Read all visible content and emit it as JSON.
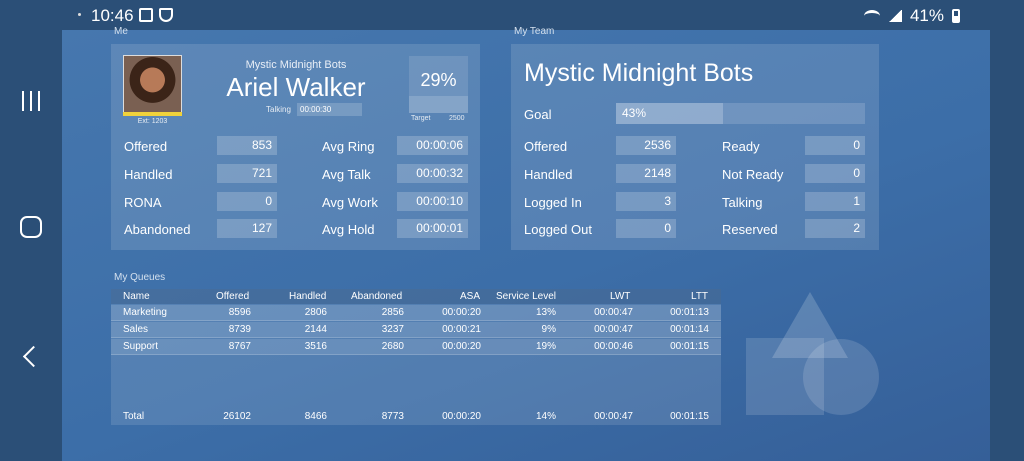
{
  "status_bar": {
    "time": "10:46",
    "battery": "41%",
    "icons": [
      "notification-icon",
      "shield-icon",
      "wifi-icon",
      "signal-icon",
      "battery-icon"
    ]
  },
  "nav_bar": {
    "icons": [
      "recents-icon",
      "home-icon",
      "back-icon"
    ]
  },
  "me": {
    "section_label": "Me",
    "team_name": "Mystic Midnight Bots",
    "agent_name": "Ariel Walker",
    "ext": "Ext: 1203",
    "state_label": "Talking",
    "state_time": "00:00:30",
    "target_pct": "29%",
    "target_pct_value": 0.29,
    "target_label": "Target",
    "target_value": "2500",
    "stats_left": [
      {
        "label": "Offered",
        "value": "853"
      },
      {
        "label": "Handled",
        "value": "721"
      },
      {
        "label": "RONA",
        "value": "0"
      },
      {
        "label": "Abandoned",
        "value": "127"
      }
    ],
    "stats_right": [
      {
        "label": "Avg Ring",
        "value": "00:00:06"
      },
      {
        "label": "Avg Talk",
        "value": "00:00:32"
      },
      {
        "label": "Avg Work",
        "value": "00:00:10"
      },
      {
        "label": "Avg Hold",
        "value": "00:00:01"
      }
    ]
  },
  "team": {
    "section_label": "My Team",
    "title": "Mystic Midnight Bots",
    "goal_label": "Goal",
    "goal_pct": "43%",
    "goal_value": 0.43,
    "stats_left": [
      {
        "label": "Offered",
        "value": "2536"
      },
      {
        "label": "Handled",
        "value": "2148"
      },
      {
        "label": "Logged In",
        "value": "3"
      },
      {
        "label": "Logged Out",
        "value": "0"
      }
    ],
    "stats_right": [
      {
        "label": "Ready",
        "value": "0"
      },
      {
        "label": "Not Ready",
        "value": "0"
      },
      {
        "label": "Talking",
        "value": "1"
      },
      {
        "label": "Reserved",
        "value": "2"
      }
    ]
  },
  "queues": {
    "section_label": "My Queues",
    "columns": [
      "Name",
      "Offered",
      "Handled",
      "Abandoned",
      "ASA",
      "Service Level",
      "LWT",
      "LTT"
    ],
    "rows": [
      [
        "Marketing",
        "8596",
        "2806",
        "2856",
        "00:00:20",
        "13%",
        "00:00:47",
        "00:01:13"
      ],
      [
        "Sales",
        "8739",
        "2144",
        "3237",
        "00:00:21",
        "9%",
        "00:00:47",
        "00:01:14"
      ],
      [
        "Support",
        "8767",
        "3516",
        "2680",
        "00:00:20",
        "19%",
        "00:00:46",
        "00:01:15"
      ]
    ],
    "total": [
      "Total",
      "26102",
      "8466",
      "8773",
      "00:00:20",
      "14%",
      "00:00:47",
      "00:01:15"
    ]
  },
  "colors": {
    "background": "#4677ae",
    "chrome": "#2b4f77",
    "accent_yellow": "#f0d23b"
  }
}
